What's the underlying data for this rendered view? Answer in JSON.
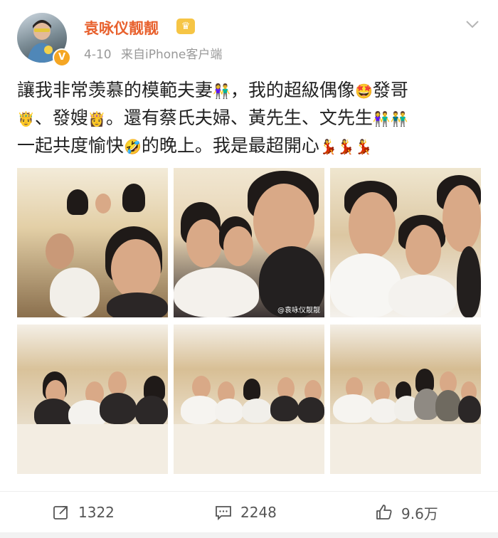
{
  "header": {
    "username": "袁咏仪靓靓",
    "date": "4-10",
    "source": "来自iPhone客户端",
    "verified_badge": "V",
    "crown_icon": "crown-icon",
    "chevron_icon": "chevron-down-icon"
  },
  "post": {
    "line1_a": "讓我非常羡慕的模範夫妻",
    "line1_b": "，我的超級偶像",
    "line1_c": "發哥",
    "line2_a": "、發嫂",
    "line2_b": "。還有蔡氏夫婦、黃先生、文先生",
    "line3_a": "一起共度愉快",
    "line3_b": "的晚上。我是最超開心"
  },
  "photos": {
    "watermark_1": "@袁咏仪靓靓",
    "watermark_2": "@袁咏仪靓靓"
  },
  "toolbar": {
    "repost_count": "1322",
    "comment_count": "2248",
    "like_count": "9.6万"
  },
  "colors": {
    "username": "#e8612e",
    "meta": "#999999",
    "verified": "#f5a623",
    "crown": "#f6c545"
  }
}
